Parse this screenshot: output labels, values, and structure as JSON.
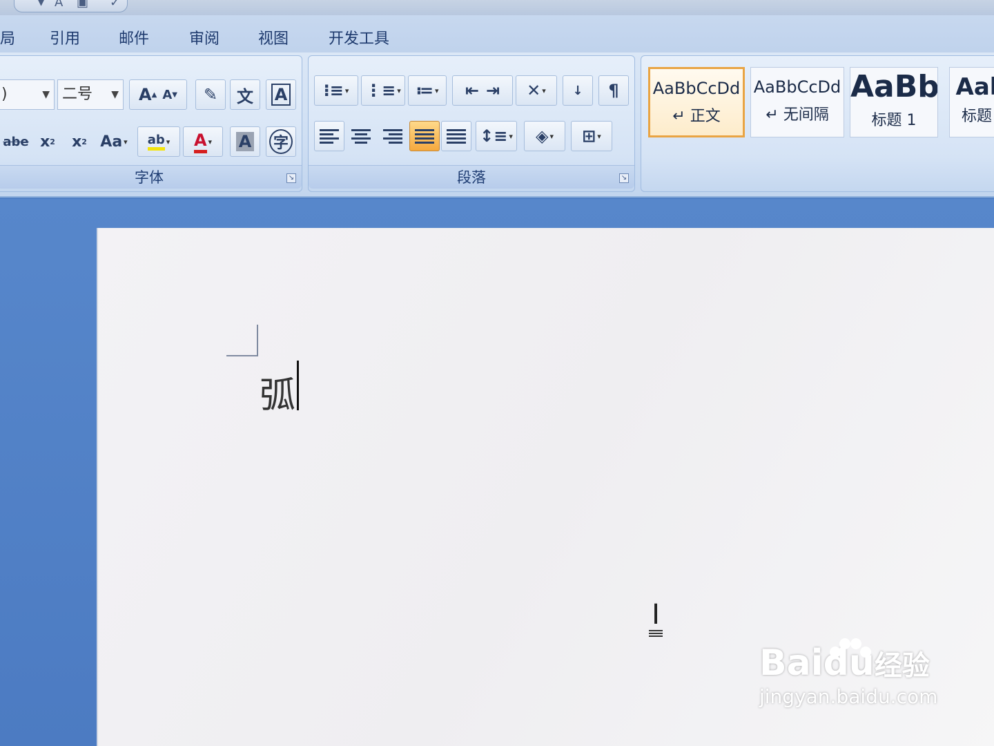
{
  "tabs": [
    "局",
    "引用",
    "邮件",
    "审阅",
    "视图",
    "开发工具"
  ],
  "font_group": {
    "label": "字体",
    "font_name_fragment": ")",
    "font_size": "二号",
    "buttons_row1": [
      "A",
      "A",
      "",
      "文",
      "A"
    ],
    "buttons_row2": [
      "abe",
      "x",
      "x",
      "Aa",
      "ab",
      "A",
      "A",
      "字"
    ]
  },
  "paragraph_group": {
    "label": "段落"
  },
  "styles": [
    {
      "sample": "AaBbCcDd",
      "name": "↵ 正文",
      "selected": true
    },
    {
      "sample": "AaBbCcDd",
      "name": "↵ 无间隔",
      "selected": false
    },
    {
      "sample": "AaBb",
      "name": "标题 1",
      "selected": false
    },
    {
      "sample": "Aal",
      "name": "标题",
      "selected": false
    }
  ],
  "document": {
    "text": "弧"
  },
  "watermark": {
    "logo_left": "Bai",
    "logo_mid": "du",
    "logo_right": "经验",
    "url": "jingyan.baidu.com"
  },
  "colors": {
    "accent_selected": "#e9a443",
    "ribbon": "#d5e3f5",
    "workspace": "#4f7fc4"
  }
}
